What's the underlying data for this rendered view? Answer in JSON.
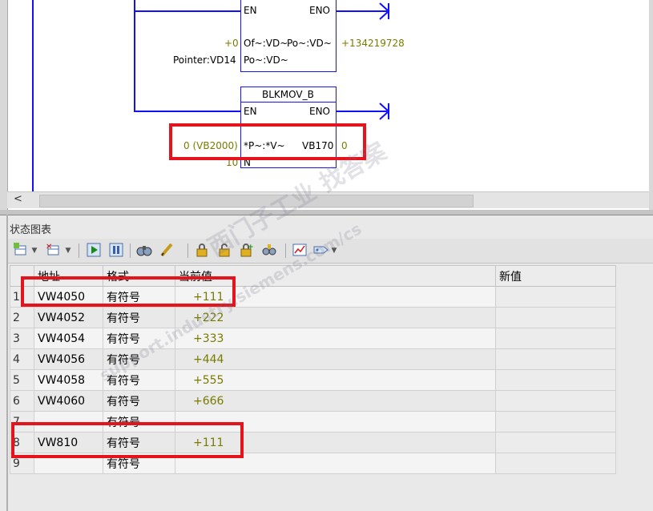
{
  "ladder": {
    "block1": {
      "en": "EN",
      "eno": "ENO",
      "pin_of": "Of~:VD~",
      "pin_po": "Po~:VD~",
      "pin_po2": "Po~:VD~",
      "in_val": "+0",
      "out_val": "+134219728",
      "pointer_label": "Pointer:VD14"
    },
    "block2": {
      "title": "BLKMOV_B",
      "en": "EN",
      "eno": "ENO",
      "pin_pv": "*P~:*V~",
      "out_label": "VB170",
      "out_val": "0",
      "in_val": "0 (VB2000)",
      "n_pin": "N",
      "n_val": "10"
    }
  },
  "scroll": {
    "left_arrow": "<"
  },
  "panel": {
    "title": "状态图表"
  },
  "toolbar": {
    "icons": [
      "add-row-icon",
      "delete-row-icon",
      "run-icon",
      "pause-icon",
      "binoculars-icon",
      "pencil-icon",
      "lock-icon",
      "unlock-icon",
      "force-icon",
      "unforce-all-icon",
      "trend-icon",
      "tag-icon"
    ]
  },
  "table": {
    "headers": [
      "",
      "地址",
      "格式",
      "当前值",
      "新值"
    ],
    "rows": [
      {
        "num": "1",
        "address": "VW4050",
        "format": "有符号",
        "current": "+111",
        "new": ""
      },
      {
        "num": "2",
        "address": "VW4052",
        "format": "有符号",
        "current": "+222",
        "new": ""
      },
      {
        "num": "3",
        "address": "VW4054",
        "format": "有符号",
        "current": "+333",
        "new": ""
      },
      {
        "num": "4",
        "address": "VW4056",
        "format": "有符号",
        "current": "+444",
        "new": ""
      },
      {
        "num": "5",
        "address": "VW4058",
        "format": "有符号",
        "current": "+555",
        "new": ""
      },
      {
        "num": "6",
        "address": "VW4060",
        "format": "有符号",
        "current": "+666",
        "new": ""
      },
      {
        "num": "7",
        "address": "",
        "format": "有符号",
        "current": "",
        "new": ""
      },
      {
        "num": "8",
        "address": "VW810",
        "format": "有符号",
        "current": "+111",
        "new": ""
      },
      {
        "num": "9",
        "address": "",
        "format": "有符号",
        "current": "",
        "new": ""
      }
    ]
  },
  "watermark": {
    "line1": "西门子工业  找答案",
    "line2": "support.industry.siemens.com/cs"
  },
  "colors": {
    "wire": "#1010ff",
    "value": "#7a7a00",
    "highlight": "#e4131c"
  }
}
